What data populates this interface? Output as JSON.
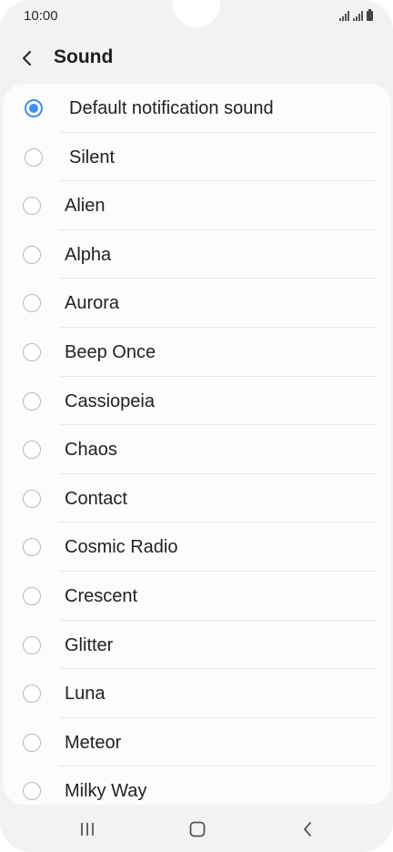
{
  "status_bar": {
    "time": "10:00"
  },
  "header": {
    "title": "Sound"
  },
  "sounds": [
    {
      "label": "Default notification sound",
      "selected": true
    },
    {
      "label": "Silent",
      "selected": false
    },
    {
      "label": "Alien",
      "selected": false
    },
    {
      "label": "Alpha",
      "selected": false
    },
    {
      "label": "Aurora",
      "selected": false
    },
    {
      "label": "Beep Once",
      "selected": false
    },
    {
      "label": "Cassiopeia",
      "selected": false
    },
    {
      "label": "Chaos",
      "selected": false
    },
    {
      "label": "Contact",
      "selected": false
    },
    {
      "label": "Cosmic Radio",
      "selected": false
    },
    {
      "label": "Crescent",
      "selected": false
    },
    {
      "label": "Glitter",
      "selected": false
    },
    {
      "label": "Luna",
      "selected": false
    },
    {
      "label": "Meteor",
      "selected": false
    },
    {
      "label": "Milky Way",
      "selected": false
    }
  ],
  "colors": {
    "accent": "#3e8ef7",
    "background": "#f2f2f2",
    "card": "#fcfcfc"
  },
  "icons": {
    "back": "chevron-left-icon",
    "recents": "recents-icon",
    "home": "home-icon",
    "nav_back": "back-icon"
  }
}
